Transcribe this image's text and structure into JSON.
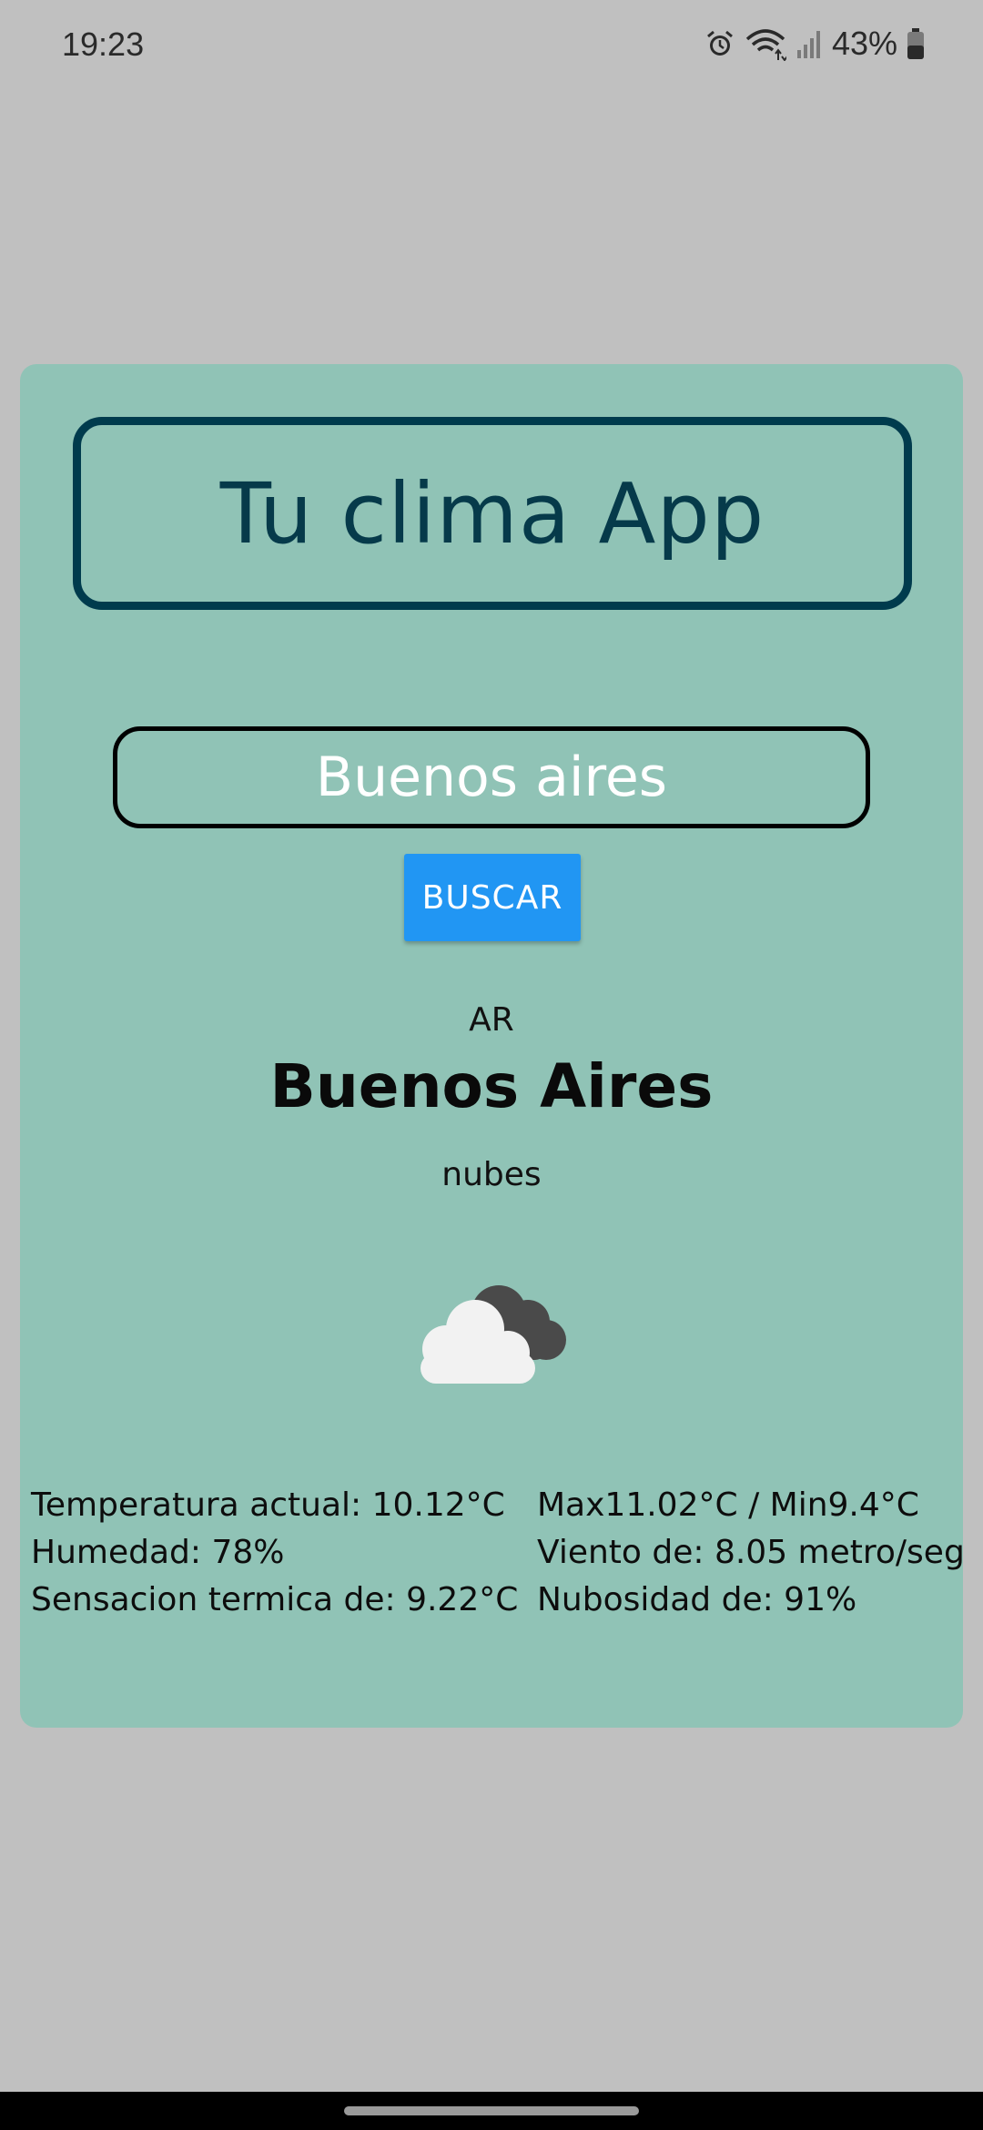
{
  "status_bar": {
    "time": "19:23",
    "battery_percent": "43%",
    "icons": [
      "alarm-icon",
      "wifi-icon",
      "signal-icon",
      "battery-icon"
    ]
  },
  "app": {
    "title": "Tu clima App",
    "search_value": "Buenos aires",
    "search_button_label": "BUSCAR"
  },
  "result": {
    "country": "AR",
    "city": "Buenos Aires",
    "description": "nubes",
    "icon": "cloud-icon"
  },
  "details": {
    "left": [
      "Temperatura actual: 10.12°C",
      "Humedad: 78%",
      "Sensacion termica de: 9.22°C"
    ],
    "right": [
      "Max11.02°C  / Min9.4°C",
      "Viento de: 8.05 metro/seg",
      "Nubosidad de: 91%"
    ]
  },
  "colors": {
    "background": "#c0c0c0",
    "card": "#90c3b6",
    "title_border": "#003b4d",
    "button": "#2196f3"
  }
}
